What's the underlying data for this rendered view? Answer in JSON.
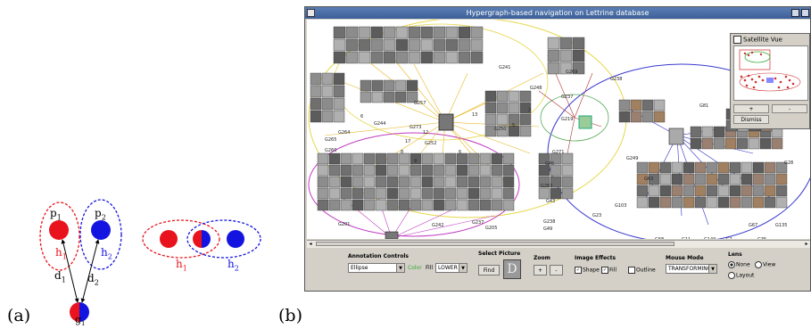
{
  "panels": {
    "a_label": "(a)",
    "b_label": "(b)"
  },
  "diagram_a": {
    "p1": "p",
    "p1_sub": "1",
    "p2": "p",
    "p2_sub": "2",
    "h1": "h",
    "h1_sub": "1",
    "h2": "h",
    "h2_sub": "2",
    "d1": "d",
    "d1_sub": "1",
    "d2": "d",
    "d2_sub": "2",
    "g1": "g",
    "g1_sub": "1",
    "right_h1": "h",
    "right_h1_sub": "1",
    "right_h2": "h",
    "right_h2_sub": "2",
    "colors": {
      "red": "#e8131c",
      "blue": "#1414e0"
    }
  },
  "window": {
    "title": "Hypergraph-based navigation on Lettrine database",
    "canvas_labels": [
      "G241",
      "G269",
      "G238",
      "G248",
      "G237",
      "G219",
      "G257",
      "G273",
      "G244",
      "G264",
      "G265",
      "G260",
      "G252",
      "G250",
      "G271",
      "G45",
      "G249",
      "G63",
      "G262",
      "G43",
      "G49",
      "G201",
      "G242",
      "G237",
      "G205",
      "G238",
      "G23",
      "G103",
      "G81",
      "G28",
      "G67",
      "G135",
      "G68",
      "G11",
      "G149",
      "G1",
      "G35"
    ],
    "edge_numbers": [
      "17",
      "12",
      "6",
      "13",
      "5",
      "8",
      "9",
      "6",
      "2"
    ]
  },
  "satellite": {
    "checkbox_label": "Satellite Vue",
    "btn_plus": "+",
    "btn_minus": "-",
    "btn_dismiss": "Dismiss"
  },
  "controls": {
    "annotation": {
      "title": "Annotation Controls",
      "shape_value": "Ellipse",
      "color_label": "Color",
      "fill_label": "Fill",
      "layer_value": "LOWER"
    },
    "select_picture": {
      "title": "Select Picture",
      "find_label": "Find"
    },
    "zoom": {
      "title": "Zoom",
      "plus": "+",
      "minus": "-"
    },
    "image_effects": {
      "title": "Image Effects",
      "shape_label": "Shape",
      "fill_label": "Fill",
      "outline_label": "Outline"
    },
    "mouse_mode": {
      "title": "Mouse Mode",
      "value": "TRANSFORMING"
    },
    "lens": {
      "title": "Lens",
      "none_label": "None",
      "view_label": "View",
      "layout_label": "Layout"
    }
  }
}
